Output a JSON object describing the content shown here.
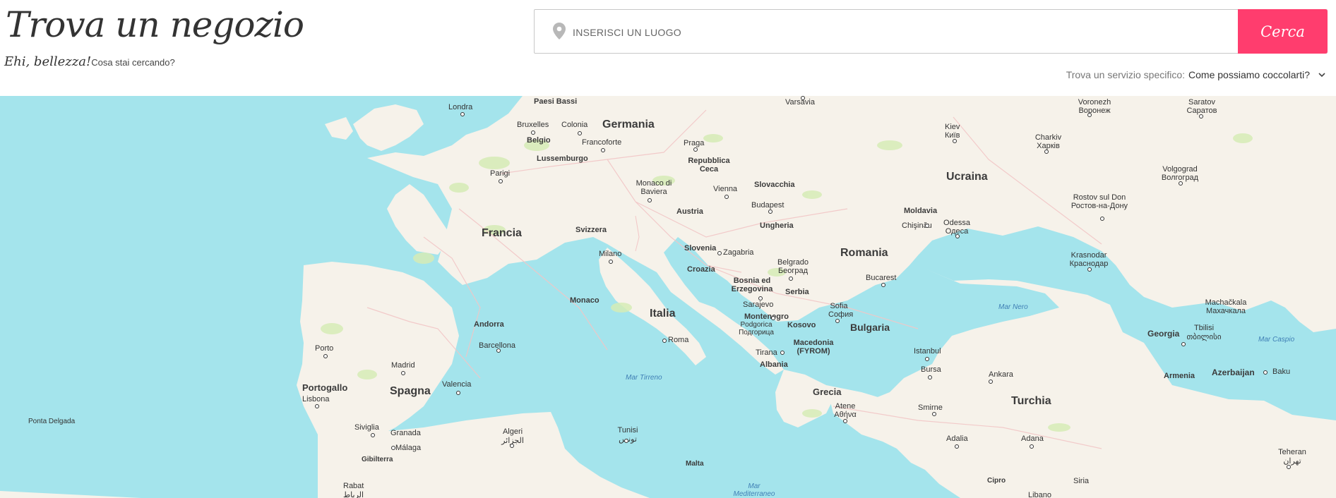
{
  "header": {
    "title": "Trova un negozio",
    "subtitle_script": "Ehi, bellezza!",
    "subtitle_question": "Cosa stai cercando?"
  },
  "search": {
    "placeholder": "INSERISCI UN LUOGO",
    "value": "",
    "button_label": "Cerca",
    "icon": "location-pin-icon"
  },
  "service_filter": {
    "label": "Trova un servizio specifico:",
    "selected": "Come possiamo coccolarti?",
    "icon": "chevron-down-icon"
  },
  "colors": {
    "accent": "#ff3d6e",
    "water": "#aadaff",
    "land": "#f7f4ee",
    "park": "#d6ecb6",
    "road": "#f2c6c6"
  },
  "map": {
    "countries": [
      "Germania",
      "Belgio",
      "Lussemburgo",
      "Repubblica Ceca",
      "Slovacchia",
      "Austria",
      "Ungheria",
      "Ucraina",
      "Moldavia",
      "Francia",
      "Svizzera",
      "Slovenia",
      "Croazia",
      "Bosnia ed Erzegovina",
      "Serbia",
      "Romania",
      "Montenegro",
      "Kosovo",
      "Bulgaria",
      "Macedonia (FYROM)",
      "Albania",
      "Italia",
      "Monaco",
      "Andorra",
      "Portogallo",
      "Spagna",
      "Grecia",
      "Turchia",
      "Georgia",
      "Armenia",
      "Azerbaijan",
      "Malta",
      "Cipro",
      "Siria",
      "Libano",
      "Paesi Bassi"
    ],
    "cities": [
      "Londra",
      "Bruxelles",
      "Colonia",
      "Francoforte",
      "Praga",
      "Parigi",
      "Monaco di Baviera",
      "Vienna",
      "Budapest",
      "Varsavia",
      "Kiev Київ",
      "Charkiv Харків",
      "Voronezh Воронеж",
      "Saratov Саратов",
      "Volgograd Волгоград",
      "Rostov sul Don Ростов-на-Дону",
      "Chişinău",
      "Odessa Одеса",
      "Krasnodar Краснодар",
      "Zagabria",
      "Belgrado Београд",
      "Bucarest",
      "Milano",
      "Sarajevo",
      "Podgorica Подгорица",
      "Sofia София",
      "Tirana",
      "Roma",
      "Barcellona",
      "Madrid",
      "Valencia",
      "Porto",
      "Lisbona",
      "Siviglia",
      "Granada",
      "Málaga",
      "Gibilterra",
      "Algeri الجزائر",
      "Tunisi تونس",
      "Rabat الرباط",
      "Atene Αθήνα",
      "Istanbul",
      "Bursa",
      "Ankara",
      "Smirne",
      "Adalia",
      "Adana",
      "Tbilisi თბილისი",
      "Baku",
      "Machačkala Махачкала",
      "Teheran تهران",
      "Ponta Delgada"
    ],
    "seas": [
      "Mar Nero",
      "Mar Tirreno",
      "Mar Caspio",
      "Mar Mediterraneo"
    ]
  }
}
